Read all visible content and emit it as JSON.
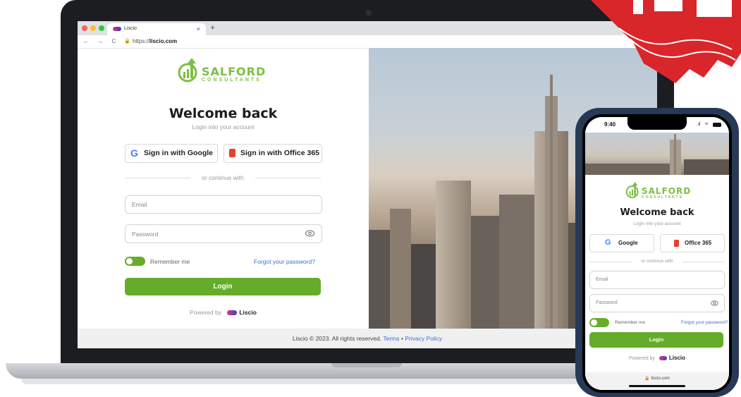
{
  "browser": {
    "tab_title": "Liscio",
    "tab_close": "×",
    "new_tab": "+",
    "nav_icons": "← → C",
    "url_prefix": "https://",
    "url_domain": "liscio.com"
  },
  "brand": {
    "name": "SALFORD",
    "tagline": "CONSULTANTS"
  },
  "login": {
    "heading": "Welcome back",
    "subheading": "Login into your account",
    "google_label": "Sign in with Google",
    "office_label": "Sign in with Office 365",
    "divider": "or continue with",
    "email_placeholder": "Email",
    "password_placeholder": "Password",
    "remember_label": "Remember me",
    "forgot_label": "Forgot your password?",
    "login_button": "Login",
    "powered_by": "Powered by",
    "powered_brand": "Liscio"
  },
  "footer": {
    "copyright": "Liscio © 2023. All rights reserved.",
    "terms": "Terms",
    "separator": "•",
    "privacy": "Privacy Policy"
  },
  "phone": {
    "time": "9:40",
    "google_label": "Google",
    "office_label": "Office 365",
    "url": "liscio.com"
  },
  "colors": {
    "accent_green": "#64ac2a",
    "link_blue": "#3c6fd8",
    "ribbon_red": "#d9262b"
  }
}
